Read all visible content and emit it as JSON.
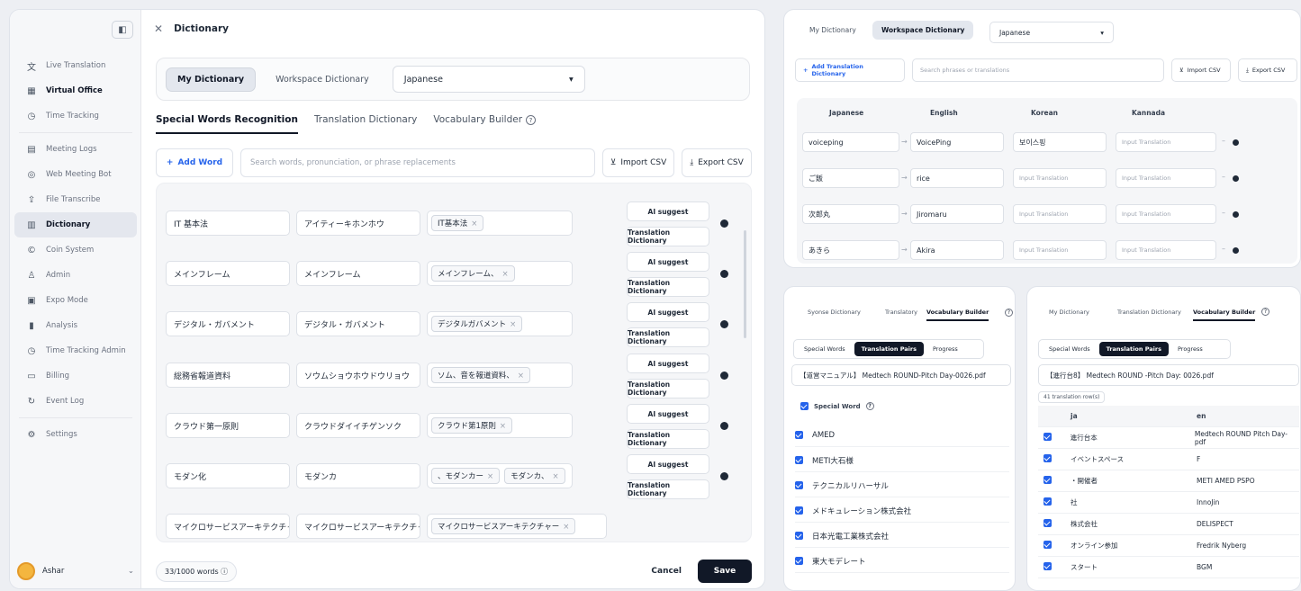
{
  "sidebar": {
    "items": [
      {
        "label": "Live Translation",
        "icon": "translate-icon",
        "glyph": "文",
        "style": ""
      },
      {
        "label": "Virtual Office",
        "icon": "office-icon",
        "glyph": "▦",
        "style": "bold"
      },
      {
        "label": "Time Tracking",
        "icon": "clock-icon",
        "glyph": "◷",
        "style": ""
      },
      {
        "label": "Meeting Logs",
        "icon": "meeting-log-icon",
        "glyph": "▤",
        "style": ""
      },
      {
        "label": "Web Meeting Bot",
        "icon": "bot-icon",
        "glyph": "◎",
        "style": ""
      },
      {
        "label": "File Transcribe",
        "icon": "upload-icon",
        "glyph": "⇪",
        "style": ""
      },
      {
        "label": "Dictionary",
        "icon": "book-icon",
        "glyph": "▥",
        "style": "active"
      },
      {
        "label": "Coin System",
        "icon": "coin-icon",
        "glyph": "©",
        "style": ""
      },
      {
        "label": "Admin",
        "icon": "users-icon",
        "glyph": "♙",
        "style": ""
      },
      {
        "label": "Expo Mode",
        "icon": "expo-icon",
        "glyph": "▣",
        "style": ""
      },
      {
        "label": "Analysis",
        "icon": "chart-icon",
        "glyph": "▮",
        "style": ""
      },
      {
        "label": "Time Tracking Admin",
        "icon": "clock-admin-icon",
        "glyph": "◷",
        "style": ""
      },
      {
        "label": "Billing",
        "icon": "card-icon",
        "glyph": "▭",
        "style": ""
      },
      {
        "label": "Event Log",
        "icon": "event-log-icon",
        "glyph": "↻",
        "style": ""
      },
      {
        "label": "Settings",
        "icon": "gear-icon",
        "glyph": "⚙",
        "style": ""
      }
    ],
    "user": "Ashar"
  },
  "header": {
    "title": "Dictionary"
  },
  "tabs": {
    "my": "My Dictionary",
    "workspace": "Workspace Dictionary",
    "language": "Japanese"
  },
  "subtabs": [
    "Special Words Recognition",
    "Translation Dictionary",
    "Vocabulary Builder"
  ],
  "toolbar": {
    "add": "Add Word",
    "search_placeholder": "Search words, pronunciation, or phrase replacements",
    "import": "Import CSV",
    "export": "Export CSV"
  },
  "actions": {
    "ai": "AI suggest",
    "td": "Translation Dictionary"
  },
  "words": [
    {
      "word": "IT 基本法",
      "reading": "アイティーキホンホウ",
      "tags": [
        "IT基本法"
      ]
    },
    {
      "word": "メインフレーム",
      "reading": "メインフレーム",
      "tags": [
        "メインフレーム、"
      ]
    },
    {
      "word": "デジタル・ガバメント",
      "reading": "デジタル・ガバメント",
      "tags": [
        "デジタルガバメント"
      ]
    },
    {
      "word": "総務省報道資料",
      "reading": "ソウムショウホウドウリョウ",
      "tags": [
        "ソム、音を報道資料、"
      ]
    },
    {
      "word": "クラウド第一原則",
      "reading": "クラウドダイイチゲンソク",
      "tags": [
        "クラウド第1原則"
      ]
    },
    {
      "word": "モダン化",
      "reading": "モダンカ",
      "tags": [
        "、モダンカー",
        "モダンカ、"
      ]
    },
    {
      "word": "マイクロサービスアーキテクチャ",
      "reading": "マイクロサービスアーキテクチャ",
      "tags": [
        "マイクロサービスアーキテクチャー"
      ]
    }
  ],
  "footer": {
    "count": "33/1000 words",
    "cancel": "Cancel",
    "save": "Save"
  },
  "rtop": {
    "my": "My Dictionary",
    "workspace": "Workspace Dictionary",
    "language": "Japanese",
    "add": "Add Translation Dictionary",
    "search_placeholder": "Search phrases or translations",
    "import": "Import CSV",
    "export": "Export CSV",
    "headers": [
      "Japanese",
      "English",
      "Korean",
      "Kannada"
    ],
    "placeholder": "Input Translation",
    "rows": [
      {
        "ja": "voiceping",
        "en": "VoicePing",
        "ko": "보이스핑"
      },
      {
        "ja": "ご飯",
        "en": "rice",
        "ko": ""
      },
      {
        "ja": "次郎丸",
        "en": "Jiromaru",
        "ko": ""
      },
      {
        "ja": "あきら",
        "en": "Akira",
        "ko": ""
      }
    ]
  },
  "bl": {
    "tabs": [
      "Syonse Dictionary",
      "Translatory",
      "Vocabulary Builder"
    ],
    "sub": [
      "Special Words",
      "Translation Pairs",
      "Progress"
    ],
    "file": "【道営マニュアル】 Medtech ROUND-Pitch Day-0026.pdf",
    "section": "Special Word",
    "words": [
      "AMED",
      "METI大石様",
      "テクニカルリハーサル",
      "メドキュレーション株式会社",
      "日本光電工業株式会社",
      "東大モデレート"
    ]
  },
  "br": {
    "tabs": [
      "My Dictionary",
      "Translation Dictionary",
      "Vocabulary Builder"
    ],
    "sub": [
      "Special Words",
      "Translation Pairs",
      "Progress"
    ],
    "file": "【進行台8】 Medtech ROUND -Pitch Day: 0026.pdf",
    "badge": "41 translation row(s)",
    "cols": [
      "ja",
      "en"
    ],
    "pairs": [
      {
        "ja": "進行台本",
        "en": "Medtech ROUND Pitch Day- pdf"
      },
      {
        "ja": "イベントスペース",
        "en": "F"
      },
      {
        "ja": "・開催者",
        "en": "METI AMED PSPO"
      },
      {
        "ja": "社",
        "en": "InnoJin"
      },
      {
        "ja": "株式会社",
        "en": "DELISPECT"
      },
      {
        "ja": "オンライン参加",
        "en": "Fredrik Nyberg"
      },
      {
        "ja": "スタート",
        "en": "BGM"
      }
    ]
  }
}
